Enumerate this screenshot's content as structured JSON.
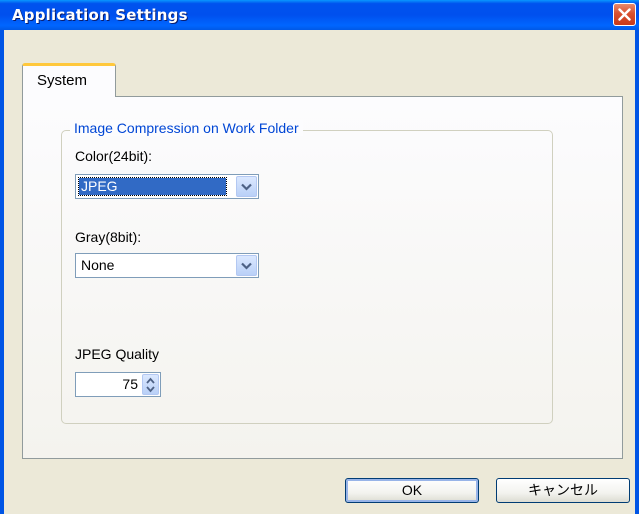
{
  "window": {
    "title": "Application Settings",
    "close_icon": "close-icon"
  },
  "tabs": [
    {
      "label": "System",
      "selected": true
    }
  ],
  "group": {
    "legend": "Image Compression on Work Folder",
    "color_label": "Color(24bit):",
    "color_value": "JPEG",
    "gray_label": "Gray(8bit):",
    "gray_value": "None",
    "quality_label": "JPEG Quality",
    "quality_value": "75"
  },
  "buttons": {
    "ok": "OK",
    "cancel": "キャンセル"
  },
  "colors": {
    "title_bar": "#0054e3",
    "accent_tab": "#ffc83c",
    "legend_text": "#0046d5",
    "selection": "#316ac5",
    "close": "#d9502f"
  }
}
